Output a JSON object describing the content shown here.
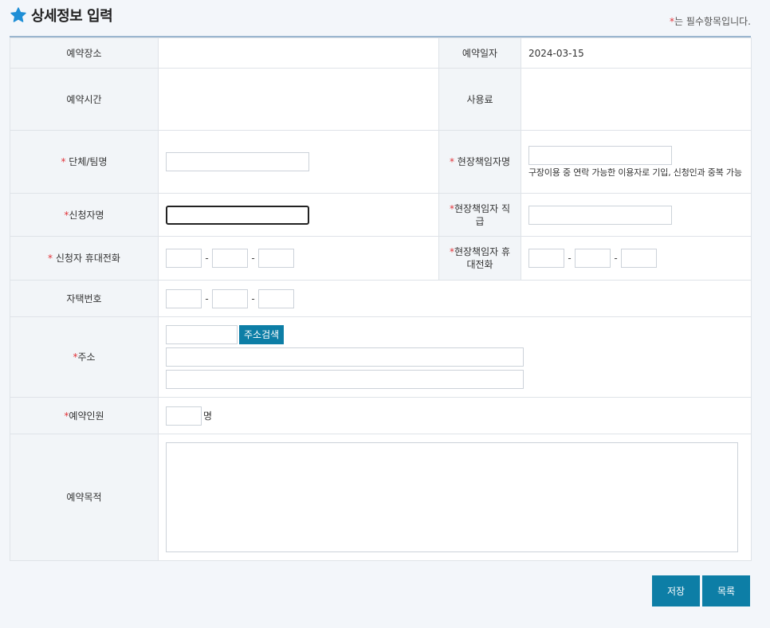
{
  "header": {
    "title": "상세정보 입력",
    "required_mark": "*",
    "required_note": "는 필수항목입니다."
  },
  "labels": {
    "place": "예약장소",
    "date": "예약일자",
    "time": "예약시간",
    "fee": "사용료",
    "team_name": "단체/팀명",
    "manager_name": "현장책임자명",
    "applicant_name": "신청자명",
    "manager_position": "현장책임자 직급",
    "applicant_phone": "신청자 휴대전화",
    "manager_phone": "현장책임자 휴대전화",
    "home_phone": "자택번호",
    "address": "주소",
    "people": "예약인원",
    "purpose": "예약목적"
  },
  "values": {
    "place": "",
    "date": "2024-03-15",
    "time": "",
    "fee": ""
  },
  "help": {
    "manager_name": "구장이용 중 연락 가능한 이용자로 기입, 신청인과 중복 가능"
  },
  "phone_separator": "-",
  "address_search_label": "주소검색",
  "people_unit": "명",
  "buttons": {
    "save": "저장",
    "list": "목록"
  },
  "colors": {
    "primary": "#0d7ea6",
    "required": "#e2343a",
    "star": "#1f8fd6"
  }
}
